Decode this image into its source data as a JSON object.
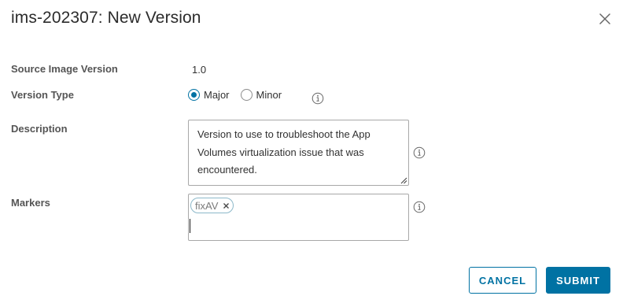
{
  "dialog": {
    "title": "ims-202307: New Version",
    "close_icon": "close-icon"
  },
  "form": {
    "source_image_version": {
      "label": "Source Image Version",
      "value": "1.0"
    },
    "version_type": {
      "label": "Version Type",
      "options": [
        {
          "label": "Major",
          "checked": true
        },
        {
          "label": "Minor",
          "checked": false
        }
      ],
      "info_icon": "info-icon"
    },
    "description": {
      "label": "Description",
      "value": "Version to use to troubleshoot the App Volumes virtualization issue that was encountered.",
      "info_icon": "info-icon"
    },
    "markers": {
      "label": "Markers",
      "chips": [
        {
          "label": "fixAV"
        }
      ],
      "info_icon": "info-icon"
    }
  },
  "footer": {
    "cancel_label": "CANCEL",
    "submit_label": "SUBMIT"
  },
  "colors": {
    "accent": "#0072a3",
    "border": "#a8a8a8",
    "label": "#555555"
  }
}
